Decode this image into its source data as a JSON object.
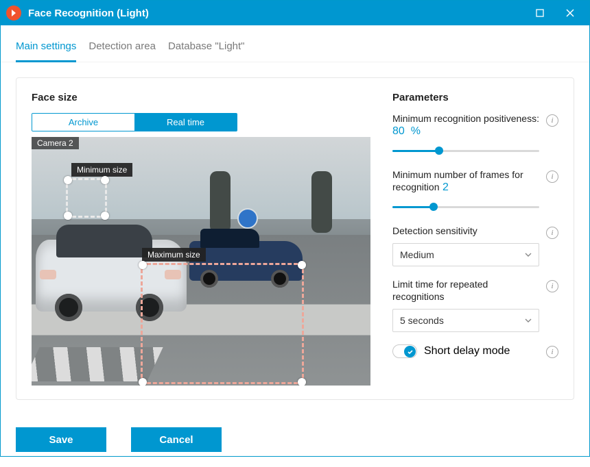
{
  "titlebar": {
    "title": "Face Recognition (Light)"
  },
  "tabs": {
    "main": "Main settings",
    "area": "Detection area",
    "db": "Database \"Light\""
  },
  "left": {
    "heading": "Face size",
    "seg_archive": "Archive",
    "seg_realtime": "Real time",
    "camera_label": "Camera 2",
    "min_label": "Minimum size",
    "max_label": "Maximum size"
  },
  "right": {
    "heading": "Parameters",
    "p1_label": "Minimum recognition positiveness:",
    "p1_value": "80",
    "p1_unit": "%",
    "p1_pct": 32,
    "p2_label": "Minimum number of frames for recognition",
    "p2_value": "2",
    "p2_pct": 28,
    "p3_label": "Detection sensitivity",
    "p3_value": "Medium",
    "p4_label": "Limit time for repeated recognitions",
    "p4_value": "5 seconds",
    "p5_label": "Short delay mode"
  },
  "footer": {
    "save": "Save",
    "cancel": "Cancel"
  }
}
